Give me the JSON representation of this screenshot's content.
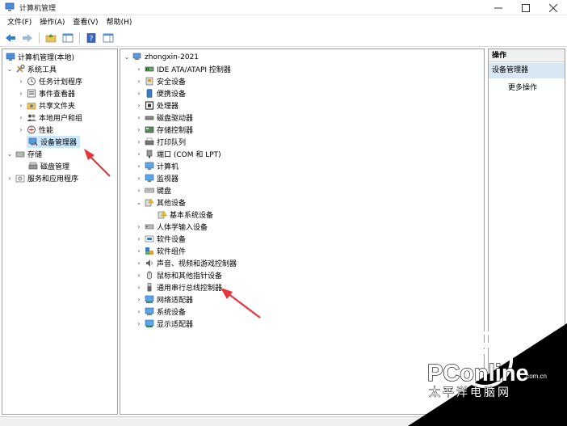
{
  "window": {
    "title": "计算机管理"
  },
  "menu": [
    {
      "id": "file",
      "label": "文件(F)"
    },
    {
      "id": "action",
      "label": "操作(A)"
    },
    {
      "id": "view",
      "label": "查看(V)"
    },
    {
      "id": "help",
      "label": "帮助(H)"
    }
  ],
  "left_tree": {
    "root": "计算机管理(本地)",
    "system_tools": "系统工具",
    "task_scheduler": "任务计划程序",
    "event_viewer": "事件查看器",
    "shared_folders": "共享文件夹",
    "local_users": "本地用户和组",
    "performance": "性能",
    "device_manager": "设备管理器",
    "storage": "存储",
    "disk_management": "磁盘管理",
    "services_apps": "服务和应用程序"
  },
  "device_tree": {
    "computer": "zhongxin-2021",
    "categories": [
      {
        "label": "IDE ATA/ATAPI 控制器",
        "icon": "ide-controller-icon"
      },
      {
        "label": "安全设备",
        "icon": "security-device-icon"
      },
      {
        "label": "便携设备",
        "icon": "portable-device-icon"
      },
      {
        "label": "处理器",
        "icon": "processor-icon"
      },
      {
        "label": "磁盘驱动器",
        "icon": "disk-drive-icon"
      },
      {
        "label": "存储控制器",
        "icon": "storage-controller-icon"
      },
      {
        "label": "打印队列",
        "icon": "print-queue-icon"
      },
      {
        "label": "端口 (COM 和 LPT)",
        "icon": "port-icon"
      },
      {
        "label": "计算机",
        "icon": "computer-icon"
      },
      {
        "label": "监视器",
        "icon": "monitor-icon"
      },
      {
        "label": "键盘",
        "icon": "keyboard-icon"
      },
      {
        "label": "其他设备",
        "icon": "other-devices-icon"
      },
      {
        "label": "人体学输入设备",
        "icon": "hid-icon"
      },
      {
        "label": "软件设备",
        "icon": "software-device-icon"
      },
      {
        "label": "软件组件",
        "icon": "software-component-icon"
      },
      {
        "label": "声音、视频和游戏控制器",
        "icon": "sound-icon"
      },
      {
        "label": "鼠标和其他指针设备",
        "icon": "mouse-icon"
      },
      {
        "label": "通用串行总线控制器",
        "icon": "usb-icon"
      },
      {
        "label": "网络适配器",
        "icon": "network-adapter-icon"
      },
      {
        "label": "系统设备",
        "icon": "system-device-icon"
      },
      {
        "label": "显示适配器",
        "icon": "display-adapter-icon"
      }
    ],
    "other_child": "基本系统设备"
  },
  "actions": {
    "header": "操作",
    "section": "设备管理器",
    "more": "更多操作"
  },
  "watermark": {
    "brand": "PConline",
    "domain": ".com.cn",
    "subtitle": "太平洋电脑网"
  },
  "colors": {
    "selection": "#cce8ff",
    "annotation_arrow": "#e8333a",
    "watermark_bg": "#000000"
  }
}
